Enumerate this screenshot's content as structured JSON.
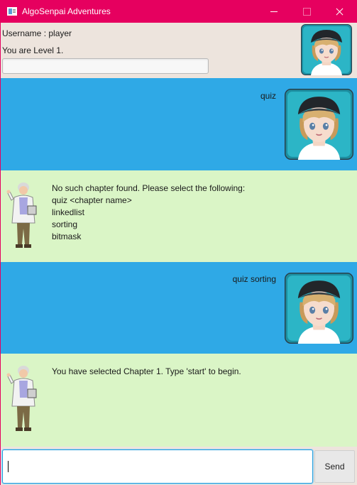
{
  "window": {
    "title": "AlgoSenpai Adventures"
  },
  "header": {
    "username_text": "Username : player",
    "level_text": "You are Level 1.",
    "progress_fraction": 0,
    "avatar_icon": "user-avatar-girl-cap"
  },
  "messages": [
    {
      "sender": "user",
      "text": "quiz",
      "avatar_icon": "user-avatar-girl-cap"
    },
    {
      "sender": "bot",
      "text": "No such chapter found. Please select the following:\nquiz <chapter name>\nlinkedlist\nsorting\nbitmask",
      "avatar_icon": "professor-avatar"
    },
    {
      "sender": "user",
      "text": "quiz sorting",
      "avatar_icon": "user-avatar-girl-cap"
    },
    {
      "sender": "bot",
      "text": "You have selected Chapter 1. Type 'start' to begin.",
      "avatar_icon": "professor-avatar"
    }
  ],
  "input": {
    "value": "",
    "placeholder": ""
  },
  "send_button": {
    "label": "Send"
  },
  "colors": {
    "titlebar": "#e6005f",
    "header_bg": "#ede4dd",
    "user_bubble": "#2fa9e6",
    "bot_bubble": "#daf5c6",
    "input_focus": "#2aa0dc"
  }
}
